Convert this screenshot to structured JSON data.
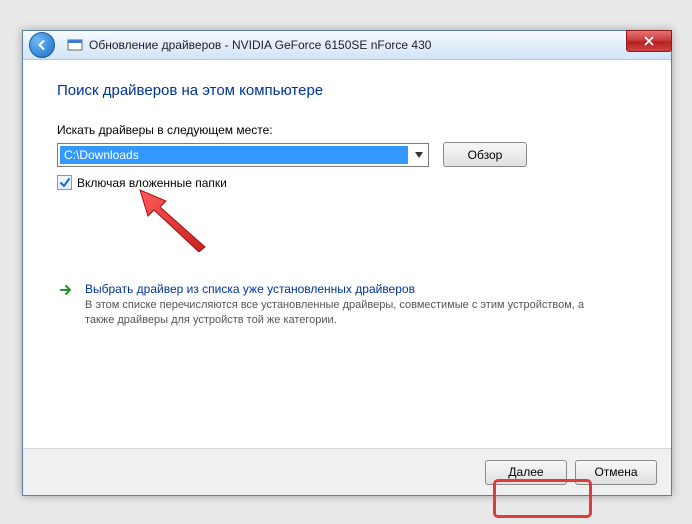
{
  "titlebar": {
    "title": "Обновление драйверов - NVIDIA GeForce 6150SE nForce 430"
  },
  "content": {
    "heading": "Поиск драйверов на этом компьютере",
    "field_label": "Искать драйверы в следующем месте:",
    "path_value": "C:\\Downloads",
    "browse_label": "Обзор",
    "include_subfolders_label": "Включая вложенные папки",
    "option": {
      "title": "Выбрать драйвер из списка уже установленных драйверов",
      "desc": "В этом списке перечисляются все установленные драйверы, совместимые с этим устройством, а также драйверы для устройств той же категории."
    }
  },
  "footer": {
    "next_label": "Далее",
    "cancel_label": "Отмена"
  }
}
